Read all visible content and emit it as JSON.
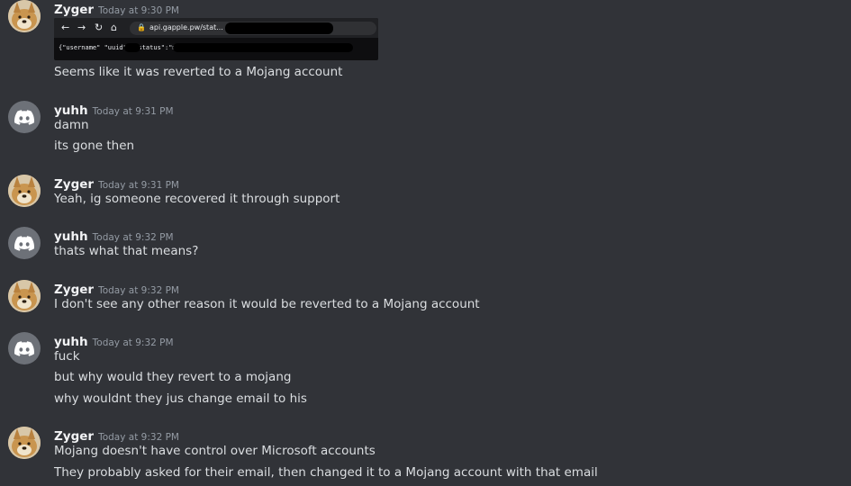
{
  "messages": [
    {
      "author": "Zyger",
      "avatar": "doge-avatar",
      "timestamp": "Today at 9:30 PM",
      "screenshot": {
        "url": "api.gapple.pw/stat...",
        "json_text": "{\"username\"      \"uuid\":                                     \"status\":\"mojang\"}"
      },
      "lines": [
        "Seems like it was reverted to a Mojang account"
      ]
    },
    {
      "author": "yuhh",
      "avatar": "discord-default-avatar",
      "timestamp": "Today at 9:31 PM",
      "lines": [
        "damn",
        "its gone then"
      ]
    },
    {
      "author": "Zyger",
      "avatar": "doge-avatar",
      "timestamp": "Today at 9:31 PM",
      "lines": [
        "Yeah, ig someone recovered it through support"
      ]
    },
    {
      "author": "yuhh",
      "avatar": "discord-default-avatar",
      "timestamp": "Today at 9:32 PM",
      "lines": [
        "thats what that means?"
      ]
    },
    {
      "author": "Zyger",
      "avatar": "doge-avatar",
      "timestamp": "Today at 9:32 PM",
      "lines": [
        "I don't see any other reason it would be reverted to a Mojang account"
      ]
    },
    {
      "author": "yuhh",
      "avatar": "discord-default-avatar",
      "timestamp": "Today at 9:32 PM",
      "lines": [
        "fuck",
        "but why would they revert to a mojang",
        "why wouldnt they jus change email to his"
      ]
    },
    {
      "author": "Zyger",
      "avatar": "doge-avatar",
      "timestamp": "Today at 9:32 PM",
      "lines": [
        "Mojang doesn't have control over Microsoft accounts",
        "They probably asked for their email, then changed it to a Mojang account with that email"
      ]
    }
  ],
  "colors": {
    "background": "#313338",
    "author": "#f2f3f5",
    "timestamp": "#949ba4",
    "text": "#dbdee1"
  }
}
